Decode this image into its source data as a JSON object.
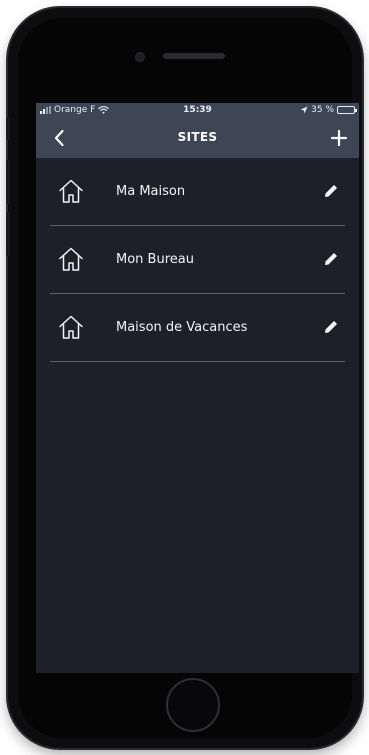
{
  "status_bar": {
    "carrier": "Orange F",
    "time": "15:39",
    "battery": "35 %"
  },
  "nav": {
    "title": "SITES",
    "back_icon": "chevron-left-icon",
    "add_icon": "plus-icon"
  },
  "sites": [
    {
      "label": "Ma Maison"
    },
    {
      "label": "Mon Bureau"
    },
    {
      "label": "Maison de Vacances"
    }
  ],
  "colors": {
    "header": "#3d4654",
    "screen_bg": "#1d2028",
    "divider": "#5a5f6a",
    "text": "#f2f3f5"
  }
}
